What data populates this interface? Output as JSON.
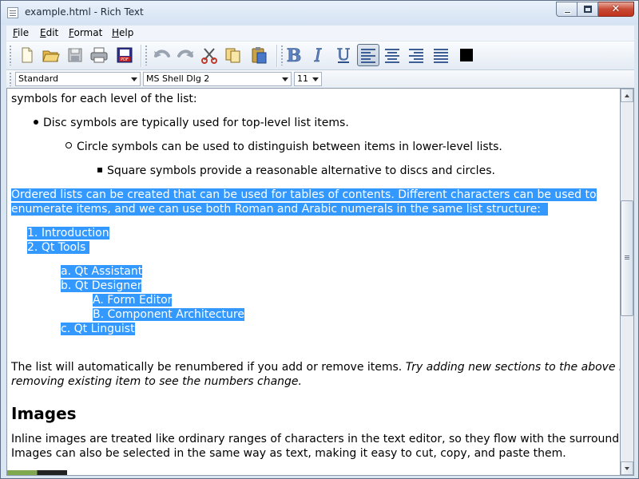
{
  "window": {
    "title": "example.html - Rich Text"
  },
  "menu": [
    {
      "label": "File",
      "mnemonic": "F",
      "rest": "ile"
    },
    {
      "label": "Edit",
      "mnemonic": "E",
      "rest": "dit"
    },
    {
      "label": "Format",
      "mnemonic": "F",
      "rest": "ormat"
    },
    {
      "label": "Help",
      "mnemonic": "H",
      "rest": "elp"
    }
  ],
  "toolbar": {
    "icons": [
      "new-document",
      "open",
      "save",
      "print",
      "export-pdf",
      "undo",
      "redo",
      "cut",
      "copy",
      "paste",
      "bold",
      "italic",
      "underline",
      "align-left",
      "align-center",
      "align-right",
      "justify",
      "text-color"
    ],
    "active": "align-left",
    "text_color": "#000000"
  },
  "format": {
    "style": "Standard",
    "font": "MS Shell Dlg 2",
    "size": "11"
  },
  "document": {
    "line1": "symbols for each level of the list:",
    "bullet_disc": "Disc symbols are typically used for top-level list items.",
    "bullet_circle": "Circle symbols can be used to distinguish between items in lower-level lists.",
    "bullet_square": "Square symbols provide a reasonable alternative to discs and circles.",
    "sel_para_1": "Ordered lists can be created that can be used for tables of contents. Different characters can be used to",
    "sel_para_2": "enumerate items, and we can use both Roman and Arabic numerals in the same list structure:",
    "ol": [
      {
        "num": "1.",
        "text": "Introduction"
      },
      {
        "num": "2.",
        "text": "Qt Tools"
      }
    ],
    "ol_sub": [
      {
        "num": "a.",
        "text": "Qt Assistant"
      },
      {
        "num": "b.",
        "text": "Qt Designer"
      },
      {
        "num": "c.",
        "text": "Qt Linguist"
      }
    ],
    "ol_subsub": [
      {
        "num": "A.",
        "text": "Form Editor"
      },
      {
        "num": "B.",
        "text": "Component Architecture"
      }
    ],
    "renumber_1": "The list will automatically be renumbered if you add or remove items.",
    "renumber_italic_1": "Try adding new sections to the above list or",
    "renumber_italic_2": "removing existing item to see the numbers change.",
    "heading_images": "Images",
    "images_1": "Inline images are treated like ordinary ranges of characters in the text editor, so they flow with the surrounding text.",
    "images_2": "Images can also be selected in the same way as text, making it easy to cut, copy, and paste them."
  }
}
